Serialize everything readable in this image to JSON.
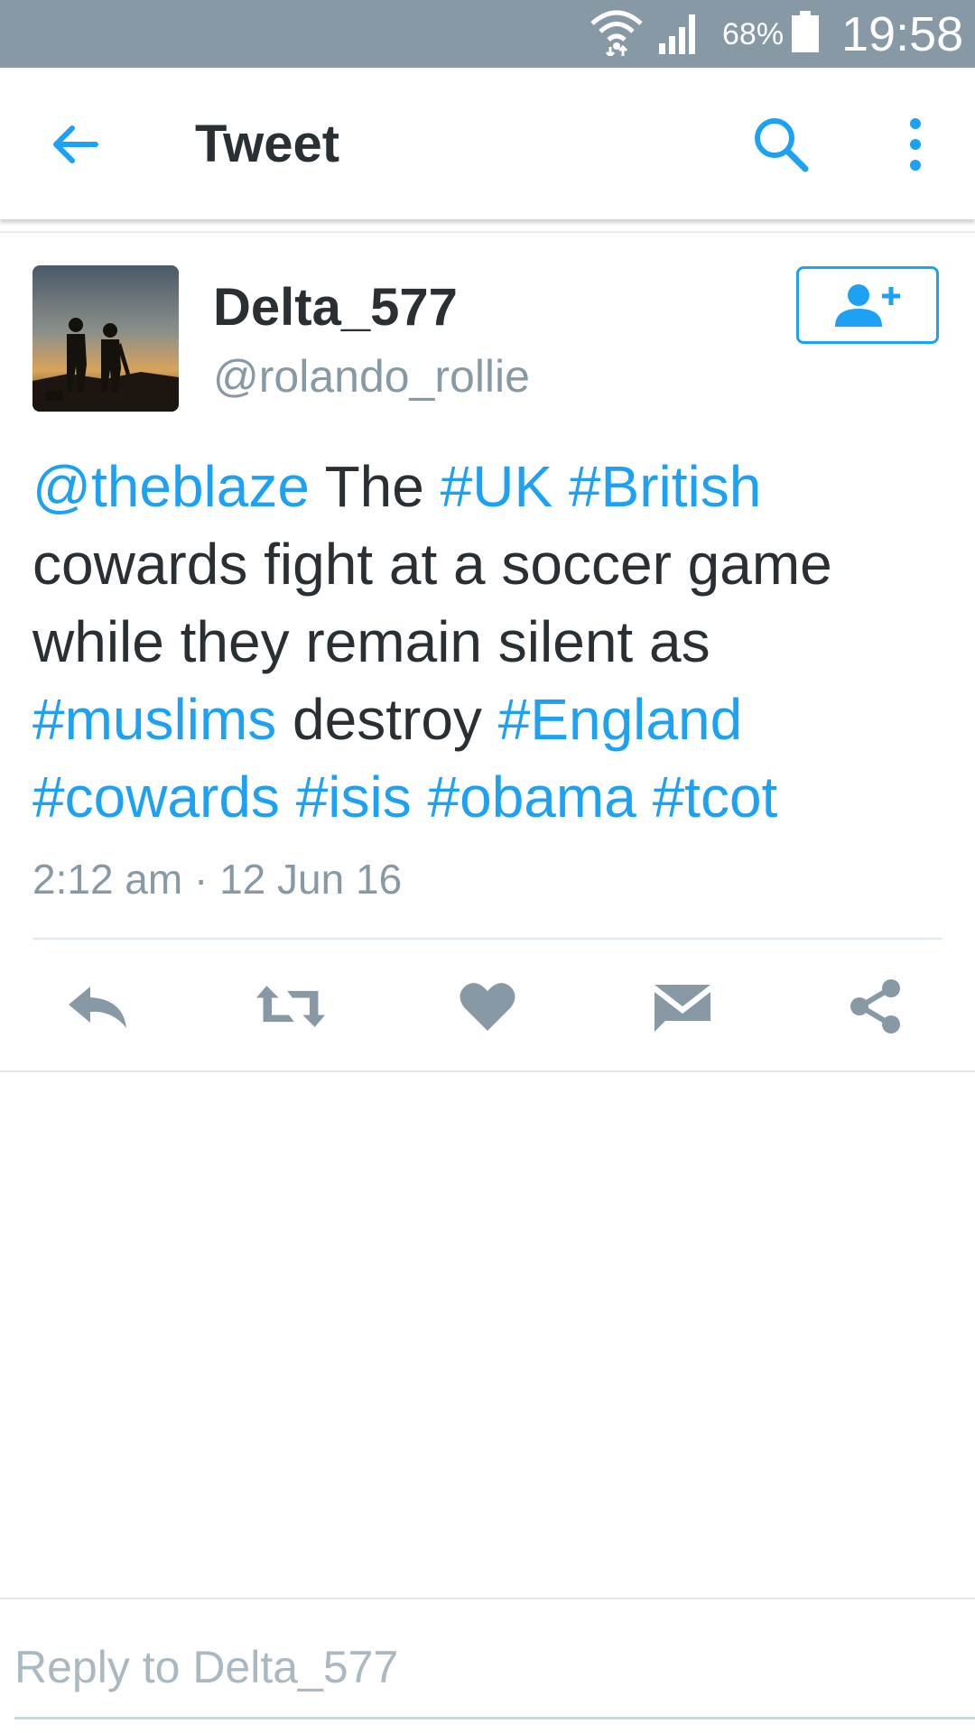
{
  "status_bar": {
    "battery_pct": "68%",
    "time": "19:58",
    "icons": [
      "wifi-icon",
      "signal-icon",
      "battery-icon"
    ]
  },
  "toolbar": {
    "title": "Tweet",
    "icons": [
      "back-arrow-icon",
      "search-icon",
      "more-vertical-icon"
    ]
  },
  "tweet": {
    "display_name": "Delta_577",
    "handle": "@rolando_rollie",
    "text_parts": [
      {
        "text": "@theblaze",
        "link": true
      },
      {
        "text": " The ",
        "link": false
      },
      {
        "text": "#UK",
        "link": true
      },
      {
        "text": " ",
        "link": false
      },
      {
        "text": "#British",
        "link": true
      },
      {
        "text": " cowards fight at a soccer game while they remain silent as ",
        "link": false
      },
      {
        "text": "#muslims",
        "link": true
      },
      {
        "text": " destroy ",
        "link": false
      },
      {
        "text": "#England",
        "link": true
      },
      {
        "text": " ",
        "link": false
      },
      {
        "text": "#cowards",
        "link": true
      },
      {
        "text": " ",
        "link": false
      },
      {
        "text": "#isis",
        "link": true
      },
      {
        "text": " ",
        "link": false
      },
      {
        "text": "#obama",
        "link": true
      },
      {
        "text": " ",
        "link": false
      },
      {
        "text": "#tcot",
        "link": true
      }
    ],
    "timestamp": "2:12 am · 12 Jun 16",
    "actions": [
      "reply-icon",
      "retweet-icon",
      "like-icon",
      "direct-message-icon",
      "share-icon"
    ]
  },
  "reply": {
    "placeholder": "Reply to Delta_577"
  },
  "colors": {
    "accent": "#1da1f2",
    "status_bar": "#8899a6",
    "text": "#292f33",
    "muted": "#8899a6"
  }
}
